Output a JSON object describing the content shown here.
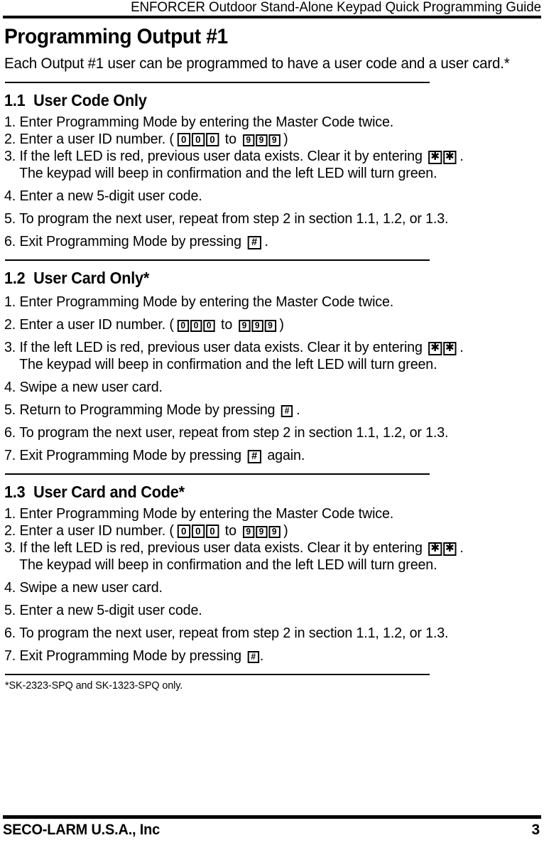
{
  "header": {
    "running_title": "ENFORCER Outdoor Stand-Alone Keypad Quick Programming Guide"
  },
  "title": "Programming Output #1",
  "intro": "Each Output #1 user can be programmed to have a user code and a user card.*",
  "sections": [
    {
      "number": "1.1",
      "heading": "1.1  User Code Only",
      "steps": {
        "s1": "1. Enter Programming Mode by entering the Master Code twice.",
        "s2_pre": "2. Enter a user ID number.  (",
        "s2_to": "to",
        "s2_post": ")",
        "s3_pre": "3. If the left LED is red, previous user data exists.  Clear it by entering",
        "s3_post": ".",
        "s3_cont": "The keypad will beep in confirmation and the left LED will turn green.",
        "s4": "4. Enter a new 5-digit user code.",
        "s5": "5. To program the next user, repeat from step 2 in section 1.1, 1.2, or 1.3.",
        "s6_pre": "6. Exit Programming Mode by pressing",
        "s6_post": "."
      }
    },
    {
      "number": "1.2",
      "heading": "1.2  User Card Only*",
      "steps": {
        "s1": "1. Enter Programming Mode by entering the Master Code twice.",
        "s2_pre": "2. Enter a user ID number.  (",
        "s2_to": "to",
        "s2_post": ")",
        "s3_pre": "3. If the left LED is red, previous user data exists.  Clear it by entering",
        "s3_post": ".",
        "s3_cont": "The keypad will beep in confirmation and the left LED will turn green.",
        "s4": "4. Swipe a new user card.",
        "s5_pre": "5. Return to Programming Mode by pressing",
        "s5_post": ".",
        "s6": "6. To program the next user, repeat from step 2 in section 1.1, 1.2, or 1.3.",
        "s7_pre": "7. Exit Programming Mode by pressing",
        "s7_post": "again."
      }
    },
    {
      "number": "1.3",
      "heading": "1.3  User Card and Code*",
      "steps": {
        "s1": "1. Enter Programming Mode by entering the Master Code twice.",
        "s2_pre": "2. Enter a user ID number.  (",
        "s2_to": "to",
        "s2_post": ")",
        "s3_pre": "3. If the left LED is red, previous user data exists.  Clear it by entering",
        "s3_post": ".",
        "s3_cont": "The keypad will beep in confirmation and the left LED will turn green.",
        "s4": "4. Swipe a new user card.",
        "s5": "5. Enter a new 5-digit user code.",
        "s6": "6. To program the next user, repeat from step 2 in section 1.1, 1.2, or 1.3.",
        "s7_pre": "7. Exit Programming Mode by pressing",
        "s7_post": "."
      }
    }
  ],
  "keys": {
    "zero": "0",
    "nine": "9",
    "star": "✱",
    "hash": "#"
  },
  "footnote": "*SK-2323-SPQ and SK-1323-SPQ only.",
  "footer": {
    "company": "SECO-LARM U.S.A., Inc",
    "page_number": "3"
  }
}
